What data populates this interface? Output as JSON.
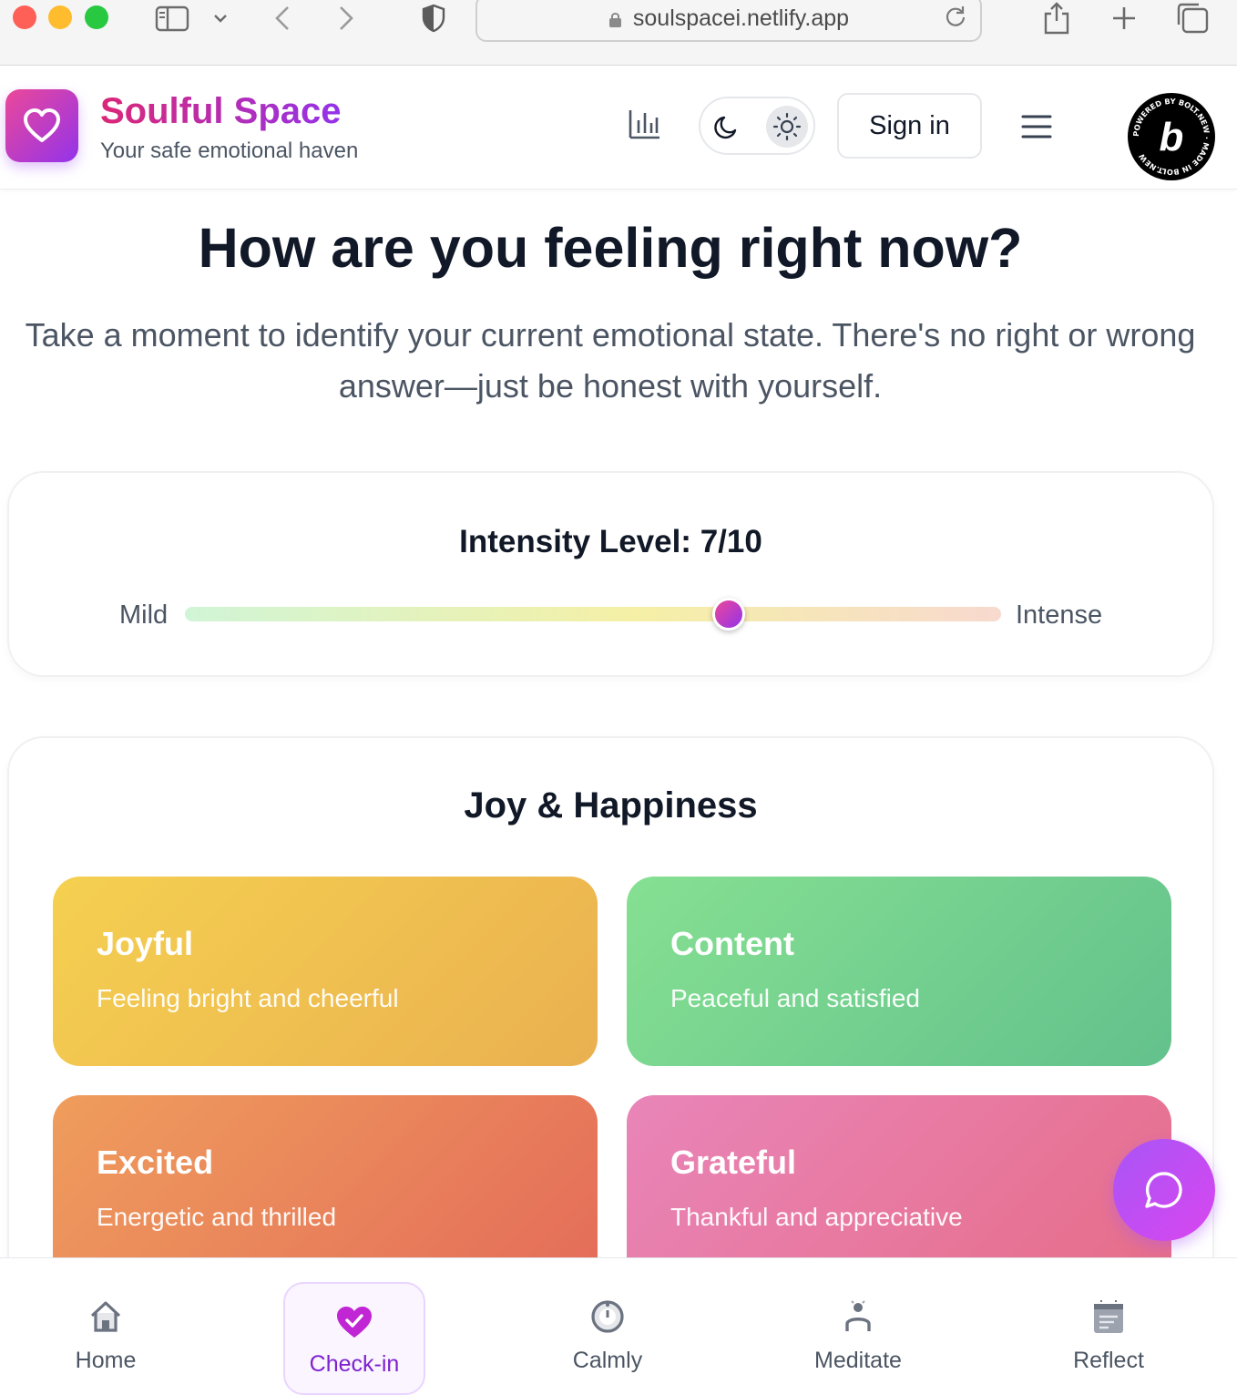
{
  "browser": {
    "url": "soulspacei.netlify.app",
    "colors": {
      "close": "#fe5f57",
      "minimize": "#febc2e",
      "maximize": "#28c840"
    }
  },
  "header": {
    "brand": "Soulful Space",
    "tagline": "Your safe emotional haven",
    "sign_in_label": "Sign in",
    "badge_text": "POWERED BY BOLT.NEW · MADE IN BOLT.NEW",
    "badge_letter": "b",
    "icons": [
      "heart-icon",
      "bar-chart-icon",
      "moon-icon",
      "sun-icon",
      "hamburger-menu-icon"
    ]
  },
  "main": {
    "title": "How are you feeling right now?",
    "intro": "Take a moment to identify your current emotional state. There's no right or wrong answer—just be honest with yourself."
  },
  "intensity": {
    "title": "Intensity Level: 7/10",
    "value": 7,
    "max": 10,
    "min_label": "Mild",
    "max_label": "Intense"
  },
  "category": {
    "title": "Joy & Happiness",
    "emotions": [
      {
        "name": "Joyful",
        "description": "Feeling bright and cheerful"
      },
      {
        "name": "Content",
        "description": "Peaceful and satisfied"
      },
      {
        "name": "Excited",
        "description": "Energetic and thrilled"
      },
      {
        "name": "Grateful",
        "description": "Thankful and appreciative"
      }
    ]
  },
  "bottom_nav": {
    "items": [
      {
        "label": "Home",
        "icon": "home-icon"
      },
      {
        "label": "Check-in",
        "icon": "heart-check-icon",
        "active": true
      },
      {
        "label": "Calmly",
        "icon": "timer-icon"
      },
      {
        "label": "Meditate",
        "icon": "meditate-icon"
      },
      {
        "label": "Reflect",
        "icon": "journal-icon"
      }
    ]
  },
  "accent": "#9333ea"
}
